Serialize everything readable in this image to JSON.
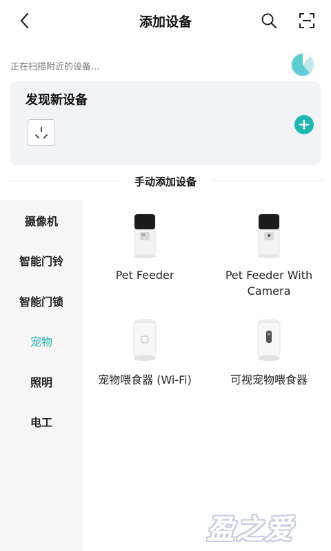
{
  "header": {
    "title": "添加设备",
    "back_icon": "chevron-left-icon",
    "search_icon": "search-icon",
    "scan_icon": "scan-icon"
  },
  "scan": {
    "status_text": "正在扫描附近的设备..."
  },
  "found": {
    "title": "发现新设备",
    "device_icon": "socket-icon",
    "add_icon": "plus-circle-icon"
  },
  "manual": {
    "title": "手动添加设备"
  },
  "categories": [
    {
      "label": "摄像机",
      "active": false
    },
    {
      "label": "智能门铃",
      "active": false
    },
    {
      "label": "智能门锁",
      "active": false
    },
    {
      "label": "宠物",
      "active": true
    },
    {
      "label": "照明",
      "active": false
    },
    {
      "label": "电工",
      "active": false
    }
  ],
  "products": [
    {
      "label_lines": [
        "Pet Feeder"
      ]
    },
    {
      "label_lines": [
        "Pet Feeder With",
        "Camera"
      ]
    },
    {
      "label_lines": [
        "宠物喂食器 (Wi-Fi)"
      ]
    },
    {
      "label_lines": [
        "可视宠物喂食器"
      ]
    }
  ],
  "watermark": {
    "text": "盈之爱"
  },
  "colors": {
    "accent": "#1fb7b0",
    "active_category": "#1fb0ad",
    "card_bg": "#f1f3f6",
    "sidebar_bg": "#f6f6f6"
  }
}
